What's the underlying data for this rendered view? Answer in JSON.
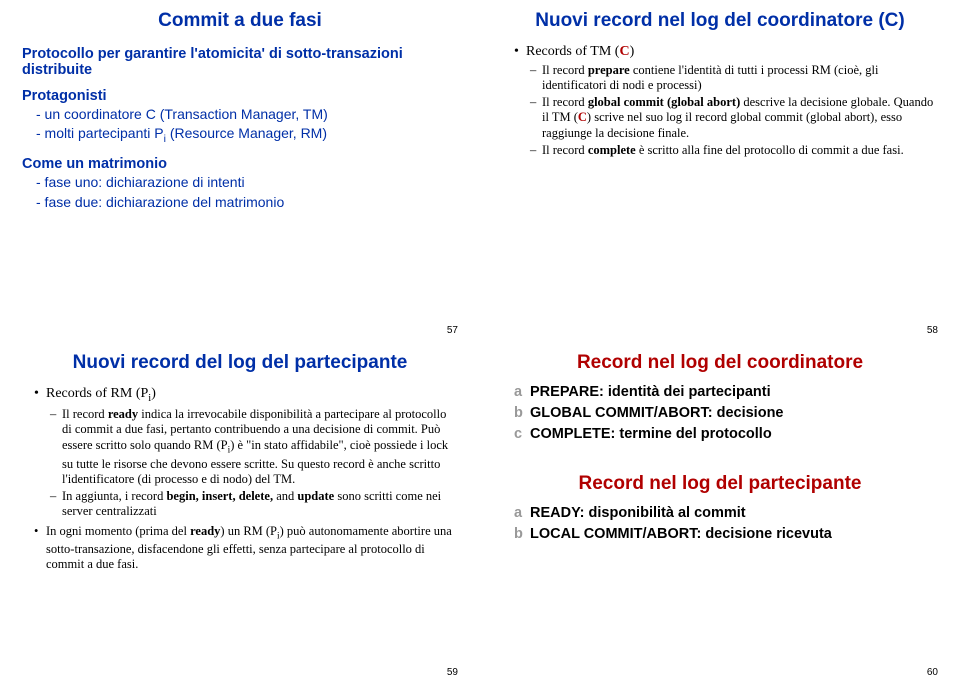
{
  "s57": {
    "title": "Commit a due fasi",
    "h1": "Protocollo per garantire l'atomicita' di sotto-transazioni distribuite",
    "h2": "Protagonisti",
    "p1": "- un coordinatore C (Transaction Manager, TM)",
    "p2_pre": "- molti partecipanti P",
    "p2_post": " (Resource Manager, RM)",
    "h3": "Come un matrimonio",
    "p3": "- fase uno: dichiarazione di intenti",
    "p4": "- fase due: dichiarazione del matrimonio",
    "page": "57"
  },
  "s58": {
    "title": "Nuovi record nel log del coordinatore (C)",
    "b1_pre": "Records of TM (",
    "b1_c": "C",
    "b1_post": ")",
    "d1": "Il record  prepare contiene l'identità di tutti i processi RM (cioè, gli identificatori di nodi e processi)",
    "d2": "Il record global commit (global abort) descrive la decisione globale. Quando il TM (C) scrive nel suo log il record global commit  (global abort), esso raggiunge la decisione finale.",
    "d3": "Il record complete è scritto alla fine del protocollo di commit a due fasi.",
    "page": "58"
  },
  "s59": {
    "title": "Nuovi record del log del partecipante",
    "b1_pre": "Records of RM (P",
    "b1_post": ")",
    "d1": "Il  record ready indica la  irrevocabile disponibilità a partecipare al protocollo di commit a due fasi, pertanto contribuendo a una decisione di commit. Può essere scritto solo quando RM (Pi) è \"in stato affidabile\", cioè possiede i lock su tutte le risorse che devono essere scritte. Su questo record è anche scritto l'identificatore (di processo e di nodo) del TM.",
    "d2": "In aggiunta, i record begin, insert, delete, and update sono scritti come nei server centralizzati",
    "b2": "In ogni momento (prima del ready) un RM (Pi) può autonomamente abortire  una sotto-transazione, disfacendone gli effetti, senza partecipare al protocollo di commit a due fasi.",
    "page": "59"
  },
  "s60": {
    "title1": "Record nel log del coordinatore",
    "a": "PREPARE: identità dei partecipanti",
    "b": "GLOBAL COMMIT/ABORT: decisione",
    "c": "COMPLETE: termine del protocollo",
    "title2": "Record nel log del partecipante",
    "a2": "READY: disponibilità al commit",
    "b2": "LOCAL COMMIT/ABORT: decisione ricevuta",
    "page": "60"
  }
}
